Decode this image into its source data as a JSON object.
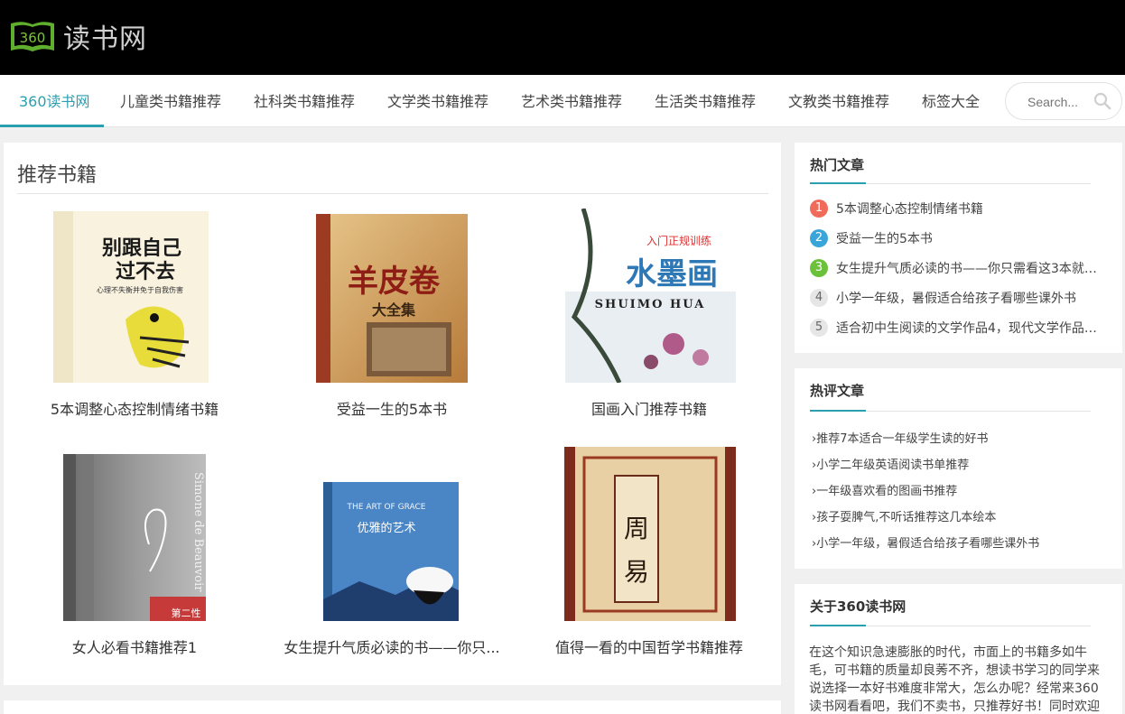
{
  "header": {
    "logo_badge": "360",
    "logo_text": "读书网"
  },
  "nav": {
    "items": [
      {
        "label": "360读书网"
      },
      {
        "label": "儿童类书籍推荐"
      },
      {
        "label": "社科类书籍推荐"
      },
      {
        "label": "文学类书籍推荐"
      },
      {
        "label": "艺术类书籍推荐"
      },
      {
        "label": "生活类书籍推荐"
      },
      {
        "label": "文教类书籍推荐"
      },
      {
        "label": "标签大全"
      }
    ],
    "search_placeholder": "Search..."
  },
  "main": {
    "title": "推荐书籍",
    "books": [
      {
        "title": "5本调整心态控制情绪书籍",
        "cover": {
          "line1": "别跟自己",
          "line2": "过不去",
          "sub": "心理不失衡并免于自我伤害"
        }
      },
      {
        "title": "受益一生的5本书",
        "cover": {
          "line1": "羊皮卷",
          "line2": "大全集"
        }
      },
      {
        "title": "国画入门推荐书籍",
        "cover": {
          "line1": "入门正规训练",
          "line2": "水墨画",
          "sub": "SHUIMO HUA"
        }
      },
      {
        "title": "女人必看书籍推荐1",
        "cover": {
          "line1": "第二性",
          "sub": "Simone de Beauvoir"
        }
      },
      {
        "title": "女生提升气质必读的书——你只...",
        "cover": {
          "line1": "THE ART OF GRACE",
          "line2": "优雅的艺术"
        }
      },
      {
        "title": "值得一看的中国哲学书籍推荐",
        "cover": {
          "line1": "周",
          "line2": "易"
        }
      }
    ]
  },
  "sidebar": {
    "hot": {
      "title": "热门文章",
      "items": [
        {
          "rank": "1",
          "text": "5本调整心态控制情绪书籍",
          "color": "#f06b5a"
        },
        {
          "rank": "2",
          "text": "受益一生的5本书",
          "color": "#3aa5d9"
        },
        {
          "rank": "3",
          "text": "女生提升气质必读的书——你只需看这3本就够...",
          "color": "#6cc13a"
        },
        {
          "rank": "4",
          "text": "小学一年级，暑假适合给孩子看哪些课外书",
          "color": ""
        },
        {
          "rank": "5",
          "text": "适合初中生阅读的文学作品4，现代文学作品推...",
          "color": ""
        }
      ]
    },
    "comments": {
      "title": "热评文章",
      "items": [
        {
          "text": "推荐7本适合一年级学生读的好书"
        },
        {
          "text": "小学二年级英语阅读书单推荐"
        },
        {
          "text": "一年级喜欢看的图画书推荐"
        },
        {
          "text": "孩子耍脾气,不听话推荐这几本绘本"
        },
        {
          "text": "小学一年级，暑假适合给孩子看哪些课外书"
        }
      ]
    },
    "about": {
      "title": "关于360读书网",
      "text": "在这个知识急速膨胀的时代，市面上的书籍多如牛毛，可书籍的质量却良莠不齐，想读书学习的同学来说选择一本好书难度非常大，怎么办呢？经常来360读书网看看吧，我们不卖书，只推荐好书！同时欢迎"
    }
  },
  "colors": {
    "accent": "#2a9fb0",
    "header_bg": "#000000"
  }
}
